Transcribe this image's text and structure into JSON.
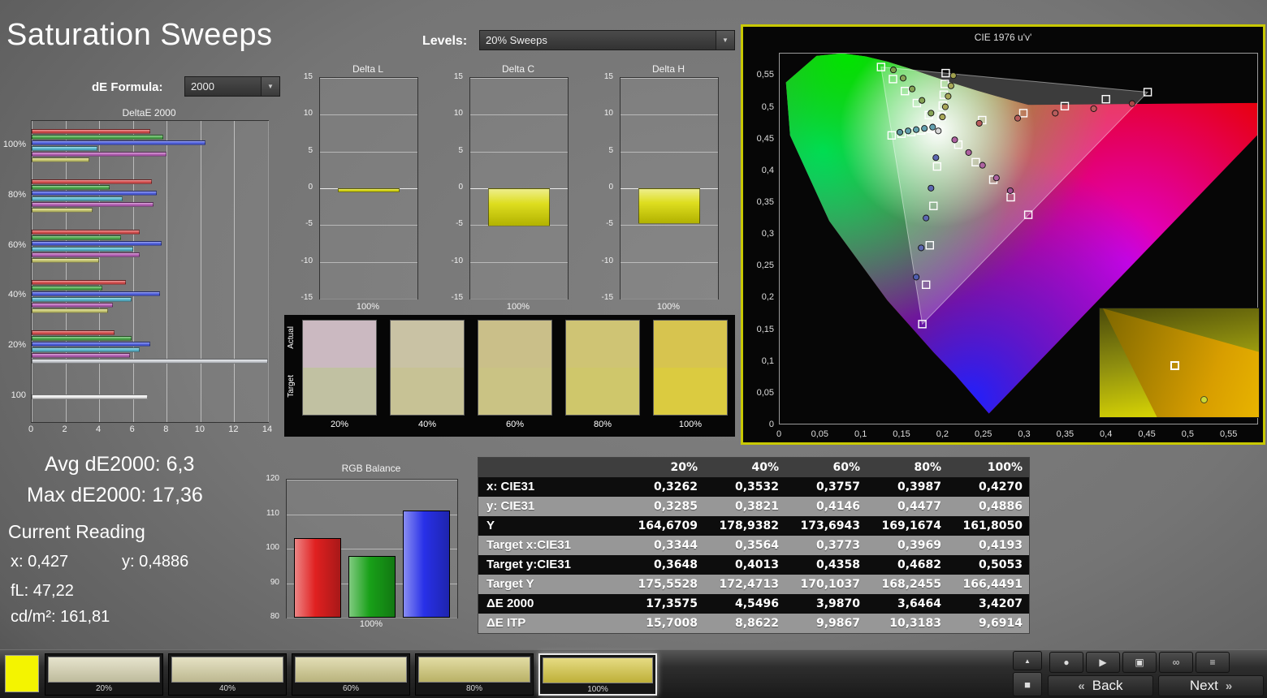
{
  "page": {
    "title": "Saturation Sweeps"
  },
  "header": {
    "levels_label": "Levels:",
    "levels_value": "20% Sweeps",
    "de_formula_label": "dE Formula:",
    "de_formula_value": "2000"
  },
  "readings": {
    "avg": "Avg dE2000: 6,3",
    "max": "Max dE2000: 17,36",
    "current": "Current Reading",
    "x": "x: 0,427",
    "y": "y: 0,4886",
    "fl": "fL: 47,22",
    "cd": "cd/m²: 161,81"
  },
  "table": {
    "headers": [
      "",
      "20%",
      "40%",
      "60%",
      "80%",
      "100%"
    ],
    "rows": [
      {
        "label": "x: CIE31",
        "values": [
          "0,3262",
          "0,3532",
          "0,3757",
          "0,3987",
          "0,4270"
        ]
      },
      {
        "label": "y: CIE31",
        "values": [
          "0,3285",
          "0,3821",
          "0,4146",
          "0,4477",
          "0,4886"
        ]
      },
      {
        "label": "Y",
        "values": [
          "164,6709",
          "178,9382",
          "173,6943",
          "169,1674",
          "161,8050"
        ]
      },
      {
        "label": "Target x:CIE31",
        "values": [
          "0,3344",
          "0,3564",
          "0,3773",
          "0,3969",
          "0,4193"
        ]
      },
      {
        "label": "Target y:CIE31",
        "values": [
          "0,3648",
          "0,4013",
          "0,4358",
          "0,4682",
          "0,5053"
        ]
      },
      {
        "label": "Target Y",
        "values": [
          "175,5528",
          "172,4713",
          "170,1037",
          "168,2455",
          "166,4491"
        ]
      },
      {
        "label": "ΔE 2000",
        "values": [
          "17,3575",
          "4,5496",
          "3,9870",
          "3,6464",
          "3,4207"
        ]
      },
      {
        "label": "ΔE ITP",
        "values": [
          "15,7008",
          "8,8622",
          "9,9867",
          "10,3183",
          "9,6914"
        ]
      }
    ]
  },
  "swatch_strip": {
    "row_labels": [
      "Actual",
      "Target"
    ],
    "columns": [
      {
        "label": "20%",
        "actual": "#cbb9c1",
        "target": "#c1c1a2"
      },
      {
        "label": "40%",
        "actual": "#c9c2a4",
        "target": "#c7c295"
      },
      {
        "label": "60%",
        "actual": "#cabf89",
        "target": "#cac384"
      },
      {
        "label": "80%",
        "actual": "#cfc474",
        "target": "#cfc76b"
      },
      {
        "label": "100%",
        "actual": "#d7c44f",
        "target": "#dbcb40"
      }
    ]
  },
  "chart_data": [
    {
      "id": "deltae2000",
      "type": "bar",
      "orientation": "horizontal",
      "title": "DeltaE 2000",
      "xlim": [
        0,
        14
      ],
      "xticks": [
        0,
        2,
        4,
        6,
        8,
        10,
        12,
        14
      ],
      "groups": [
        {
          "label": "100%",
          "bars": [
            {
              "color": "#d84444",
              "value": 7.0
            },
            {
              "color": "#44a844",
              "value": 7.8
            },
            {
              "color": "#4456e0",
              "value": 10.3
            },
            {
              "color": "#52b8d0",
              "value": 3.9
            },
            {
              "color": "#b457b4",
              "value": 8.0
            },
            {
              "color": "#c8c86a",
              "value": 3.4
            }
          ]
        },
        {
          "label": "80%",
          "bars": [
            {
              "color": "#d84444",
              "value": 7.1
            },
            {
              "color": "#44a844",
              "value": 4.6
            },
            {
              "color": "#4456e0",
              "value": 7.4
            },
            {
              "color": "#52b8d0",
              "value": 5.4
            },
            {
              "color": "#b457b4",
              "value": 7.2
            },
            {
              "color": "#c8c86a",
              "value": 3.6
            }
          ]
        },
        {
          "label": "60%",
          "bars": [
            {
              "color": "#d84444",
              "value": 6.4
            },
            {
              "color": "#44a844",
              "value": 5.3
            },
            {
              "color": "#4456e0",
              "value": 7.7
            },
            {
              "color": "#52b8d0",
              "value": 6.0
            },
            {
              "color": "#b457b4",
              "value": 6.4
            },
            {
              "color": "#c8c86a",
              "value": 4.0
            }
          ]
        },
        {
          "label": "40%",
          "bars": [
            {
              "color": "#d84444",
              "value": 5.6
            },
            {
              "color": "#44a844",
              "value": 4.2
            },
            {
              "color": "#4456e0",
              "value": 7.6
            },
            {
              "color": "#52b8d0",
              "value": 5.9
            },
            {
              "color": "#b457b4",
              "value": 4.8
            },
            {
              "color": "#c8c86a",
              "value": 4.5
            }
          ]
        },
        {
          "label": "20%",
          "bars": [
            {
              "color": "#d84444",
              "value": 4.9
            },
            {
              "color": "#44a844",
              "value": 5.9
            },
            {
              "color": "#4456e0",
              "value": 7.0
            },
            {
              "color": "#52b8d0",
              "value": 6.4
            },
            {
              "color": "#b457b4",
              "value": 5.8
            },
            {
              "color": "#ced2d8",
              "value": 17.36
            }
          ]
        },
        {
          "label": "100",
          "bars": [
            {
              "color": "#f0f0f0",
              "value": 6.9
            }
          ]
        }
      ]
    },
    {
      "id": "delta_l",
      "type": "bar",
      "title": "Delta L",
      "ylim": [
        -15,
        15
      ],
      "yticks": [
        15,
        10,
        5,
        0,
        -5,
        -10,
        -15
      ],
      "xlabel": "100%",
      "values": [
        -0.5
      ],
      "color": "#d9d900"
    },
    {
      "id": "delta_c",
      "type": "bar",
      "title": "Delta C",
      "ylim": [
        -15,
        15
      ],
      "yticks": [
        15,
        10,
        5,
        0,
        -5,
        -10,
        -15
      ],
      "xlabel": "100%",
      "values": [
        -5.2
      ],
      "color": "#d9d900"
    },
    {
      "id": "delta_h",
      "type": "bar",
      "title": "Delta H",
      "ylim": [
        -15,
        15
      ],
      "yticks": [
        15,
        10,
        5,
        0,
        -5,
        -10,
        -15
      ],
      "xlabel": "100%",
      "values": [
        -4.8
      ],
      "color": "#d9d900"
    },
    {
      "id": "rgb_balance",
      "type": "bar",
      "title": "RGB Balance",
      "ylim": [
        80,
        120
      ],
      "yticks": [
        120,
        110,
        100,
        90,
        80
      ],
      "xlabel": "100%",
      "series": [
        {
          "name": "Red",
          "value": 103,
          "color": "#e02020"
        },
        {
          "name": "Green",
          "value": 98,
          "color": "#18a018"
        },
        {
          "name": "Blue",
          "value": 111,
          "color": "#2830e8"
        }
      ]
    },
    {
      "id": "cie",
      "type": "scatter",
      "title": "CIE 1976 u'v'",
      "border_color": "#c8c800",
      "xlim": [
        0,
        0.586
      ],
      "ylim": [
        0,
        0.585
      ],
      "xtick_labels": [
        "0",
        "0,05",
        "0,1",
        "0,15",
        "0,2",
        "0,25",
        "0,3",
        "0,35",
        "0,4",
        "0,45",
        "0,5",
        "0,55"
      ],
      "ytick_labels": [
        "0",
        "0,05",
        "0,1",
        "0,15",
        "0,2",
        "0,25",
        "0,3",
        "0,35",
        "0,4",
        "0,45",
        "0,5",
        "0,55"
      ],
      "white_point": [
        0.198,
        0.468
      ],
      "gamut_triangle": [
        [
          0.451,
          0.523
        ],
        [
          0.125,
          0.5625
        ],
        [
          0.1754,
          0.158
        ]
      ],
      "locus": [
        [
          0.2569,
          0.0172
        ],
        [
          0.2161,
          0.0777
        ],
        [
          0.1898,
          0.1126
        ],
        [
          0.1327,
          0.1953
        ],
        [
          0.0617,
          0.3201
        ],
        [
          0.0137,
          0.4549
        ],
        [
          0.0086,
          0.5384
        ],
        [
          0.046,
          0.58
        ],
        [
          0.0774,
          0.5842
        ],
        [
          0.1062,
          0.5793
        ],
        [
          0.1329,
          0.571
        ],
        [
          0.1596,
          0.5602
        ],
        [
          0.1875,
          0.548
        ],
        [
          0.2155,
          0.5362
        ],
        [
          0.2418,
          0.5256
        ],
        [
          0.2663,
          0.5165
        ],
        [
          0.305,
          0.5029
        ],
        [
          0.6234,
          0.5065
        ]
      ],
      "targets": [
        [
          0.2486,
          0.479
        ],
        [
          0.299,
          0.49
        ],
        [
          0.3496,
          0.501
        ],
        [
          0.4,
          0.512
        ],
        [
          0.451,
          0.523
        ],
        [
          0.1834,
          0.4869
        ],
        [
          0.1688,
          0.5058
        ],
        [
          0.1542,
          0.5247
        ],
        [
          0.1396,
          0.5436
        ],
        [
          0.125,
          0.5625
        ],
        [
          0.1935,
          0.406
        ],
        [
          0.189,
          0.344
        ],
        [
          0.1845,
          0.282
        ],
        [
          0.18,
          0.22
        ],
        [
          0.1754,
          0.158
        ],
        [
          0.186,
          0.4654
        ],
        [
          0.174,
          0.4628
        ],
        [
          0.162,
          0.4602
        ],
        [
          0.15,
          0.4576
        ],
        [
          0.138,
          0.455
        ],
        [
          0.2194,
          0.4404
        ],
        [
          0.2408,
          0.4128
        ],
        [
          0.2622,
          0.3852
        ],
        [
          0.2836,
          0.3576
        ],
        [
          0.305,
          0.33
        ],
        [
          0.1992,
          0.485
        ],
        [
          0.2004,
          0.502
        ],
        [
          0.2016,
          0.519
        ],
        [
          0.2028,
          0.536
        ],
        [
          0.204,
          0.553
        ]
      ],
      "measurements": [
        [
          0.245,
          0.474,
          "#b85c5c"
        ],
        [
          0.292,
          0.482,
          "#b85c5c"
        ],
        [
          0.338,
          0.49,
          "#b85c5c"
        ],
        [
          0.385,
          0.497,
          "#b85c5c"
        ],
        [
          0.432,
          0.505,
          "#a84848"
        ],
        [
          0.186,
          0.49,
          "#86a455"
        ],
        [
          0.175,
          0.51,
          "#86a455"
        ],
        [
          0.163,
          0.528,
          "#86a455"
        ],
        [
          0.152,
          0.545,
          "#86a455"
        ],
        [
          0.14,
          0.558,
          "#79a04a"
        ],
        [
          0.192,
          0.42,
          "#5c68b0"
        ],
        [
          0.186,
          0.372,
          "#5c68b0"
        ],
        [
          0.18,
          0.325,
          "#5c68b0"
        ],
        [
          0.174,
          0.278,
          "#5c68b0"
        ],
        [
          0.168,
          0.232,
          "#4f5cae"
        ],
        [
          0.188,
          0.468,
          "#63a0ae"
        ],
        [
          0.178,
          0.466,
          "#63a0ae"
        ],
        [
          0.168,
          0.464,
          "#63a0ae"
        ],
        [
          0.158,
          0.462,
          "#63a0ae"
        ],
        [
          0.148,
          0.46,
          "#57919e"
        ],
        [
          0.215,
          0.448,
          "#ad62a0"
        ],
        [
          0.232,
          0.428,
          "#ad62a0"
        ],
        [
          0.249,
          0.408,
          "#ad62a0"
        ],
        [
          0.266,
          0.388,
          "#ad62a0"
        ],
        [
          0.283,
          0.368,
          "#a05090"
        ],
        [
          0.2,
          0.484,
          "#a8a858"
        ],
        [
          0.2035,
          0.5,
          "#a8a858"
        ],
        [
          0.207,
          0.5165,
          "#a8a858"
        ],
        [
          0.2105,
          0.533,
          "#a8a858"
        ],
        [
          0.2133,
          0.5491,
          "#a0a04e"
        ],
        [
          0.195,
          0.462,
          "#d8d8d8"
        ]
      ],
      "inset": {
        "square": [
          0.47,
          0.52
        ],
        "circle": [
          0.655,
          0.835
        ]
      }
    }
  ],
  "bottom_bar": {
    "current_color": "#f4f400",
    "swatches": [
      {
        "label": "20%",
        "color": "#d9d5b2",
        "selected": false
      },
      {
        "label": "40%",
        "color": "#d7d2a4",
        "selected": false
      },
      {
        "label": "60%",
        "color": "#d3cc8e",
        "selected": false
      },
      {
        "label": "80%",
        "color": "#d3ca74",
        "selected": false
      },
      {
        "label": "100%",
        "color": "#d8c840",
        "selected": true
      }
    ],
    "side_buttons": [
      {
        "name": "collapse-button",
        "glyph": "▲"
      },
      {
        "name": "display-mode-button",
        "glyph": "■"
      }
    ],
    "control_buttons": [
      {
        "name": "record-button",
        "glyph": "●"
      },
      {
        "name": "play-button",
        "glyph": "▶"
      },
      {
        "name": "pattern-button",
        "glyph": "▣"
      },
      {
        "name": "continuous-button",
        "glyph": "∞"
      },
      {
        "name": "menu-button",
        "glyph": "≡"
      }
    ],
    "back_icon": "«",
    "back_label": "Back",
    "next_label": "Next",
    "next_icon": "»"
  }
}
